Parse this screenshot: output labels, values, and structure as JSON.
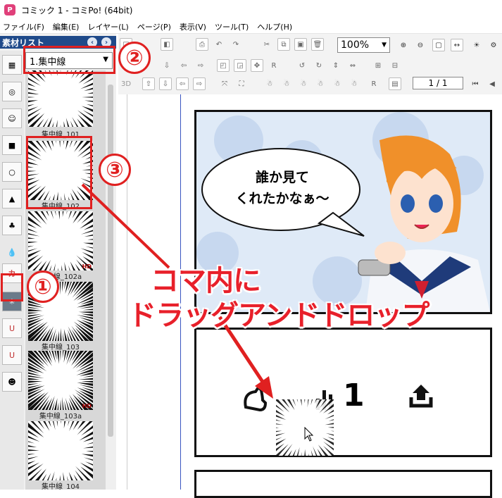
{
  "window": {
    "title": "コミック 1 - コミPo! (64bit)",
    "app_icon": "P"
  },
  "menu": [
    "ファイル(F)",
    "編集(E)",
    "レイヤー(L)",
    "ページ(P)",
    "表示(V)",
    "ツール(T)",
    "ヘルプ(H)"
  ],
  "panel": {
    "header": "素材リスト",
    "category": "1.集中線"
  },
  "thumbnails": [
    {
      "label": "集中線_101",
      "hd": ""
    },
    {
      "label": "集中線_102",
      "hd": ""
    },
    {
      "label": "集中線_102a",
      "hd": "HD"
    },
    {
      "label": "集中線_103",
      "hd": ""
    },
    {
      "label": "集中線_103a",
      "hd": "HD"
    },
    {
      "label": "集中線_104",
      "hd": ""
    }
  ],
  "toolbar": {
    "zoom": "100%",
    "label_3d": "3D",
    "page": "1 / 1"
  },
  "annotations": {
    "step1": "①",
    "step2": "②",
    "step3": "③",
    "instruction_line1": "コマ内に",
    "instruction_line2": "ドラッグアンドドロップ"
  },
  "speech_bubble": {
    "line1": "誰か見て",
    "line2": "くれたかなぁ～"
  },
  "second_panel": {
    "count": "1"
  },
  "colors": {
    "accent": "#e02020",
    "panel_header": "#1f4a8a"
  }
}
